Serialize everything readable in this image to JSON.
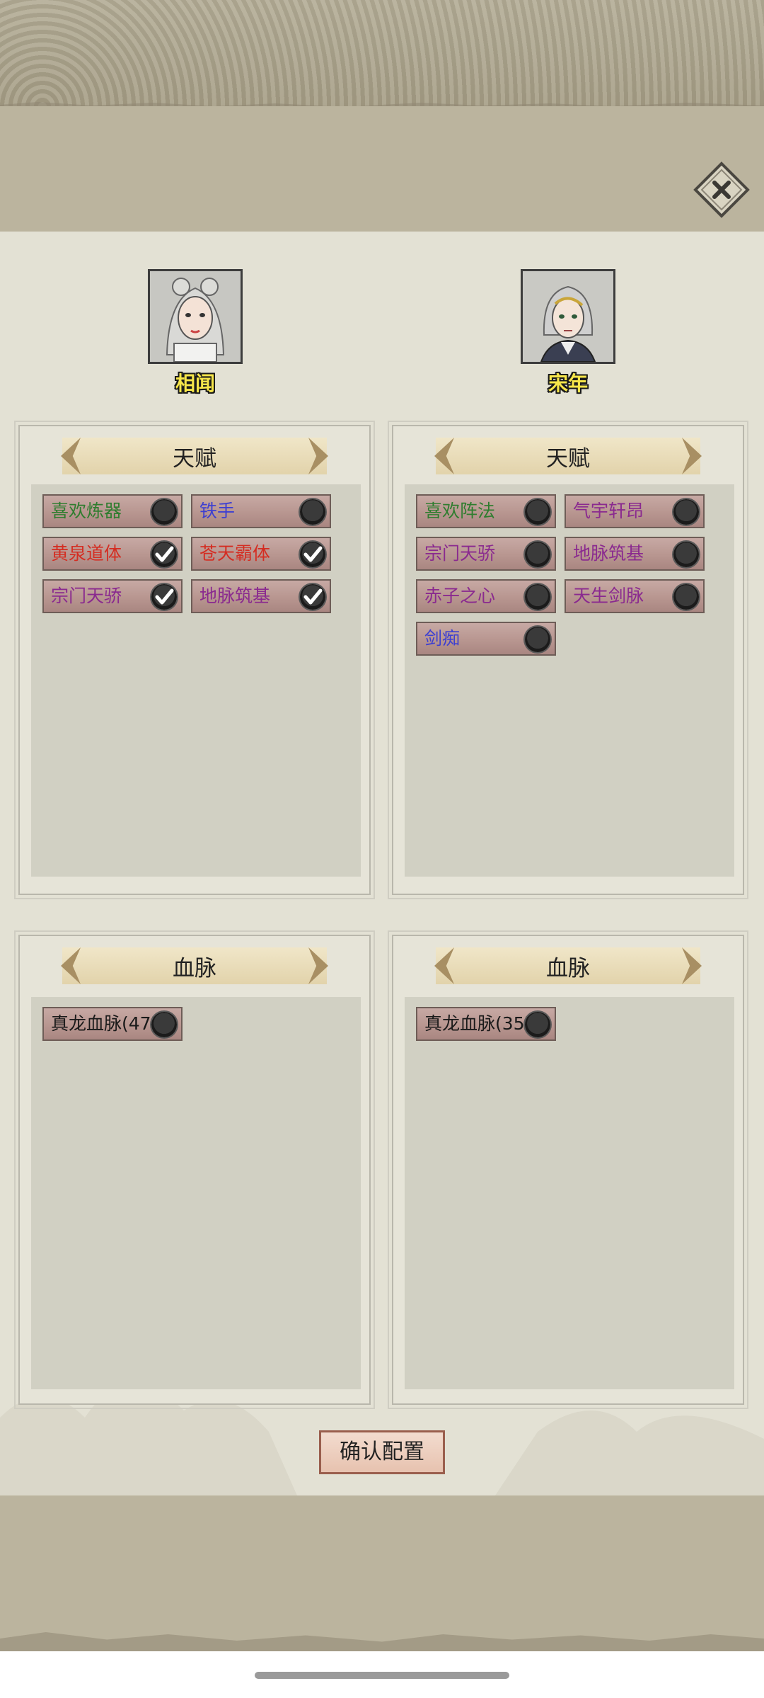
{
  "characters": [
    {
      "name": "相闻"
    },
    {
      "name": "宋年"
    }
  ],
  "talent_panels": [
    {
      "title": "天赋",
      "items": [
        {
          "label": "喜欢炼器",
          "color": "#2f7d2f",
          "checked": false
        },
        {
          "label": "铁手",
          "color": "#3d3fd1",
          "checked": false
        },
        {
          "label": "黄泉道体",
          "color": "#d42d22",
          "checked": true
        },
        {
          "label": "苍天霸体",
          "color": "#d42d22",
          "checked": true
        },
        {
          "label": "宗门天骄",
          "color": "#8a2a8f",
          "checked": true
        },
        {
          "label": "地脉筑基",
          "color": "#8a2a8f",
          "checked": true
        }
      ]
    },
    {
      "title": "天赋",
      "items": [
        {
          "label": "喜欢阵法",
          "color": "#2f7d2f",
          "checked": false
        },
        {
          "label": "气宇轩昂",
          "color": "#8a2a8f",
          "checked": false
        },
        {
          "label": "宗门天骄",
          "color": "#8a2a8f",
          "checked": false
        },
        {
          "label": "地脉筑基",
          "color": "#8a2a8f",
          "checked": false
        },
        {
          "label": "赤子之心",
          "color": "#8a2a8f",
          "checked": false
        },
        {
          "label": "天生剑脉",
          "color": "#8a2a8f",
          "checked": false
        },
        {
          "label": "剑痴",
          "color": "#3d3fd1",
          "checked": false
        }
      ]
    }
  ],
  "bloodline_panels": [
    {
      "title": "血脉",
      "items": [
        {
          "label": "真龙血脉(47)",
          "color": "#1a1a1a",
          "checked": false
        }
      ]
    },
    {
      "title": "血脉",
      "items": [
        {
          "label": "真龙血脉(35)",
          "color": "#1a1a1a",
          "checked": false
        }
      ]
    }
  ],
  "confirm_label": "确认配置",
  "icons": {
    "close": "close-icon",
    "arrow_left": "arrow-left-icon",
    "arrow_right": "arrow-right-icon",
    "check": "check-icon"
  }
}
